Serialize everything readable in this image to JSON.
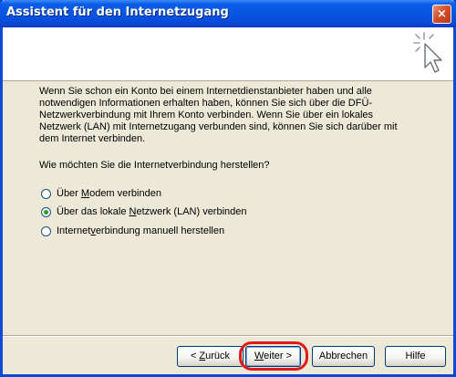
{
  "window": {
    "title": "Assistent für den Internetzugang",
    "close_glyph": "×"
  },
  "header": {
    "icon": "wizard-wand-cursor-icon"
  },
  "content": {
    "intro": "Wenn Sie schon ein Konto bei einem Internetdienstanbieter haben und alle notwendigen Informationen erhalten haben, können Sie sich über die DFÜ-Netzwerkverbindung mit Ihrem Konto verbinden. Wenn Sie über ein lokales Netzwerk (LAN) mit Internetzugang verbunden sind, können Sie sich darüber mit dem Internet verbinden.",
    "question": "Wie möchten Sie die Internetverbindung herstellen?",
    "options": [
      {
        "pre": "Über ",
        "accel": "M",
        "post": "odem verbinden",
        "checked": false
      },
      {
        "pre": "Über das lokale ",
        "accel": "N",
        "post": "etzwerk (LAN) verbinden",
        "checked": true
      },
      {
        "pre": "Internet",
        "accel": "v",
        "post": "erbindung manuell herstellen",
        "checked": false
      }
    ]
  },
  "buttons": {
    "back": {
      "pre": "< ",
      "accel": "Z",
      "post": "urück"
    },
    "next": {
      "pre": "",
      "accel": "W",
      "post": "eiter >"
    },
    "cancel": "Abbrechen",
    "help": "Hilfe"
  },
  "colors": {
    "title_bar": "#0a49d8",
    "highlight": "#e01a1a",
    "radio_dot": "#21a121",
    "dialog_bg": "#ece9d8"
  }
}
